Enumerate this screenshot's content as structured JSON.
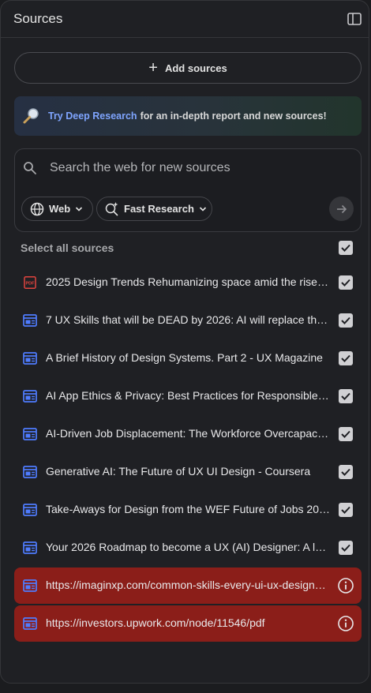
{
  "header": {
    "title": "Sources"
  },
  "add_sources": {
    "label": "Add sources"
  },
  "deep_research_banner": {
    "link_text": "Try Deep Research",
    "text": "for an in-depth report and new sources!"
  },
  "search": {
    "placeholder": "Search the web for new sources",
    "value": "",
    "source_filter": "Web",
    "research_mode": "Fast Research"
  },
  "select_all": {
    "label": "Select all sources",
    "checked": true
  },
  "sources": [
    {
      "title": "2025 Design Trends Rehumanizing space amid the rise of...",
      "type": "pdf",
      "checked": true,
      "error": false
    },
    {
      "title": "7 UX Skills that will be DEAD by 2026: AI will replace these...",
      "type": "web",
      "checked": true,
      "error": false
    },
    {
      "title": "A Brief History of Design Systems. Part 2 - UX Magazine",
      "type": "web",
      "checked": true,
      "error": false
    },
    {
      "title": "AI App Ethics & Privacy: Best Practices for Responsible AI...",
      "type": "web",
      "checked": true,
      "error": false
    },
    {
      "title": "AI-Driven Job Displacement: The Workforce Overcapacity...",
      "type": "web",
      "checked": true,
      "error": false
    },
    {
      "title": "Generative AI: The Future of UX UI Design - Coursera",
      "type": "web",
      "checked": true,
      "error": false
    },
    {
      "title": "Take-Aways for Design from the WEF Future of Jobs 2025...",
      "type": "web",
      "checked": true,
      "error": false
    },
    {
      "title": "Your 2026 Roadmap to become a UX (AI) Designer: A look...",
      "type": "web",
      "checked": true,
      "error": false
    },
    {
      "title": "https://imaginxp.com/common-skills-every-ui-ux-designer-...",
      "type": "web",
      "checked": false,
      "error": true
    },
    {
      "title": "https://investors.upwork.com/node/11546/pdf",
      "type": "web",
      "checked": false,
      "error": true
    }
  ],
  "colors": {
    "accent_link": "#7fa5ff",
    "error_row": "#8b1e19",
    "web_icon": "#4f7cff",
    "pdf_icon": "#e0443e"
  }
}
